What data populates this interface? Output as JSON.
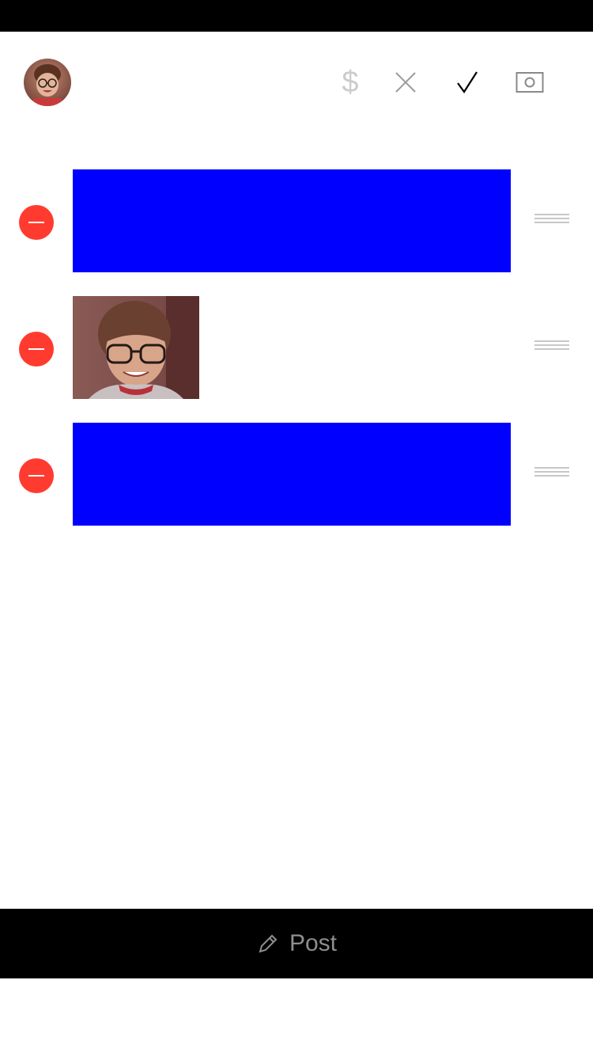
{
  "toolbar": {
    "price_symbol": "$",
    "icons": [
      "avatar",
      "dollar-icon",
      "close-icon",
      "check-icon",
      "camera-icon"
    ]
  },
  "items": [
    {
      "type": "block",
      "color": "#0000ff"
    },
    {
      "type": "photo"
    },
    {
      "type": "block",
      "color": "#0000ff"
    }
  ],
  "bottom_bar": {
    "post_label": "Post"
  },
  "colors": {
    "remove": "#ff3b30",
    "block": "#0000ff",
    "bar_background": "#000000"
  }
}
